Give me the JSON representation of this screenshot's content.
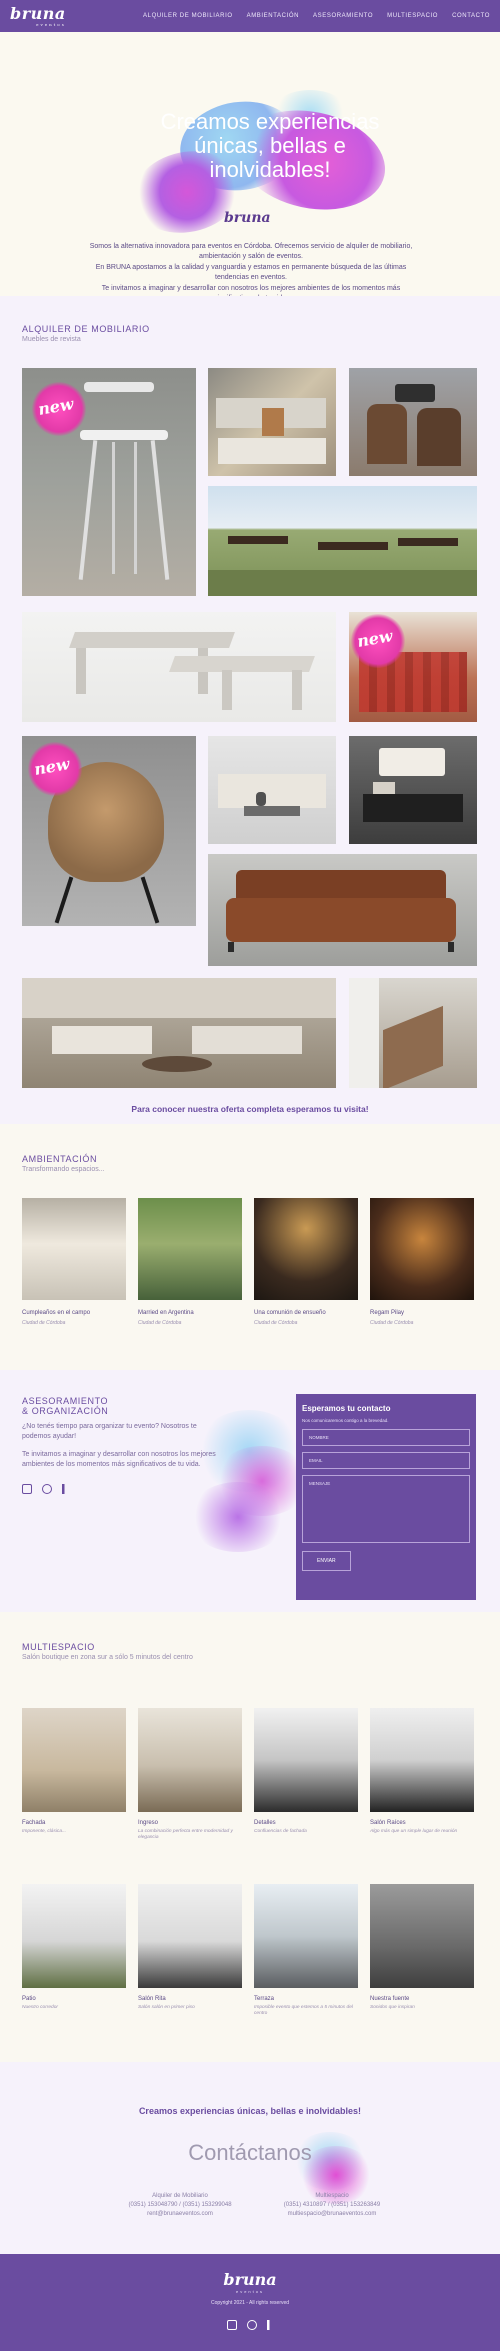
{
  "nav": {
    "brand": "bruna",
    "brand_sub": "eventos",
    "items": [
      "ALQUILER DE MOBILIARIO",
      "AMBIENTACIÓN",
      "ASESORAMIENTO",
      "MULTIESPACIO",
      "CONTACTO"
    ]
  },
  "hero": {
    "title": "Creamos experiencias únicas, bellas e inolvidables!",
    "brand": "bruna",
    "p1": "Somos la alternativa innovadora para eventos en Córdoba. Ofrecemos servicio de alquiler de mobiliario, ambientación y salón de eventos.",
    "p2": "En BRUNA apostamos a la calidad y vanguardia y estamos en permanente búsqueda de las últimas tendencias en eventos.",
    "p3": "Te invitamos a imaginar y desarrollar con nosotros los mejores ambientes de los momentos más significativos de tu vida."
  },
  "mobiliario": {
    "title": "ALQUILER DE MOBILIARIO",
    "subtitle": "Muebles de revista",
    "badge": "new",
    "cta": "Para conocer nuestra oferta completa esperamos tu visita!"
  },
  "ambientacion": {
    "title": "AMBIENTACIÓN",
    "subtitle": "Transformando espacios...",
    "cards": [
      {
        "title": "Cumpleaños en el campo",
        "sub": "Ciudad de Córdoba"
      },
      {
        "title": "Married en Argentina",
        "sub": "Ciudad de Córdoba"
      },
      {
        "title": "Una comunión de ensueño",
        "sub": "Ciudad de Córdoba"
      },
      {
        "title": "Regam Pilay",
        "sub": "Ciudad de Córdoba"
      }
    ]
  },
  "asesoramiento": {
    "title1": "ASESORAMIENTO",
    "title2": "& ORGANIZACIÓN",
    "q": "¿No tenés tiempo para organizar tu evento? Nosotros te podemos ayudar!",
    "p": "Te invitamos a imaginar y desarrollar con nosotros los mejores ambientes de los momentos más significativos de tu vida."
  },
  "form": {
    "title": "Esperamos tu contacto",
    "subtitle": "Nos comunicaremos contigo a la brevedad.",
    "name": "NOMBRE",
    "email": "EMAIL",
    "message": "MENSAJE",
    "send": "ENVIAR"
  },
  "multiespacio": {
    "title": "MULTIESPACIO",
    "subtitle": "Salón boutique en zona sur a sólo 5 minutos del centro",
    "cards": [
      {
        "title": "Fachada",
        "sub": "Imponente, clásica..."
      },
      {
        "title": "Ingreso",
        "sub": "La combinación perfecta entre modernidad y elegancia"
      },
      {
        "title": "Detalles",
        "sub": "Confluencias de fachada"
      },
      {
        "title": "Salón Raíces",
        "sub": "Algo más que un simple lugar de reunión"
      },
      {
        "title": "Patio",
        "sub": "Nuestro corredor"
      },
      {
        "title": "Salón Rita",
        "sub": "Salón salón en primer piso"
      },
      {
        "title": "Terraza",
        "sub": "Imposible evento que estemos a 5 minutos del centro"
      },
      {
        "title": "Nuestra fuente",
        "sub": "Sonidos que inspiran"
      }
    ]
  },
  "contacto": {
    "tagline": "Creamos experiencias únicas, bellas e inolvidables!",
    "title": "Contáctanos",
    "left": {
      "label": "Alquiler de Mobiliario",
      "phone": "(0351) 153048790 / (0351) 153299048",
      "email": "rent@brunaeventos.com"
    },
    "right": {
      "label": "Multiespacio",
      "phone": "(0351) 4310897 / (0351) 153263849",
      "email": "multiespacio@brunaeventos.com"
    }
  },
  "footer": {
    "brand": "bruna",
    "brand_sub": "eventos",
    "copyright": "Copyright 2021 - All rights reserved",
    "social": [
      "instagram-icon",
      "pinterest-icon",
      "facebook-icon"
    ]
  },
  "colors": {
    "primary": "#6a4ca0",
    "background": "#faf8f1",
    "accent": "#e23aa8",
    "sky": "#9fd7f2"
  }
}
